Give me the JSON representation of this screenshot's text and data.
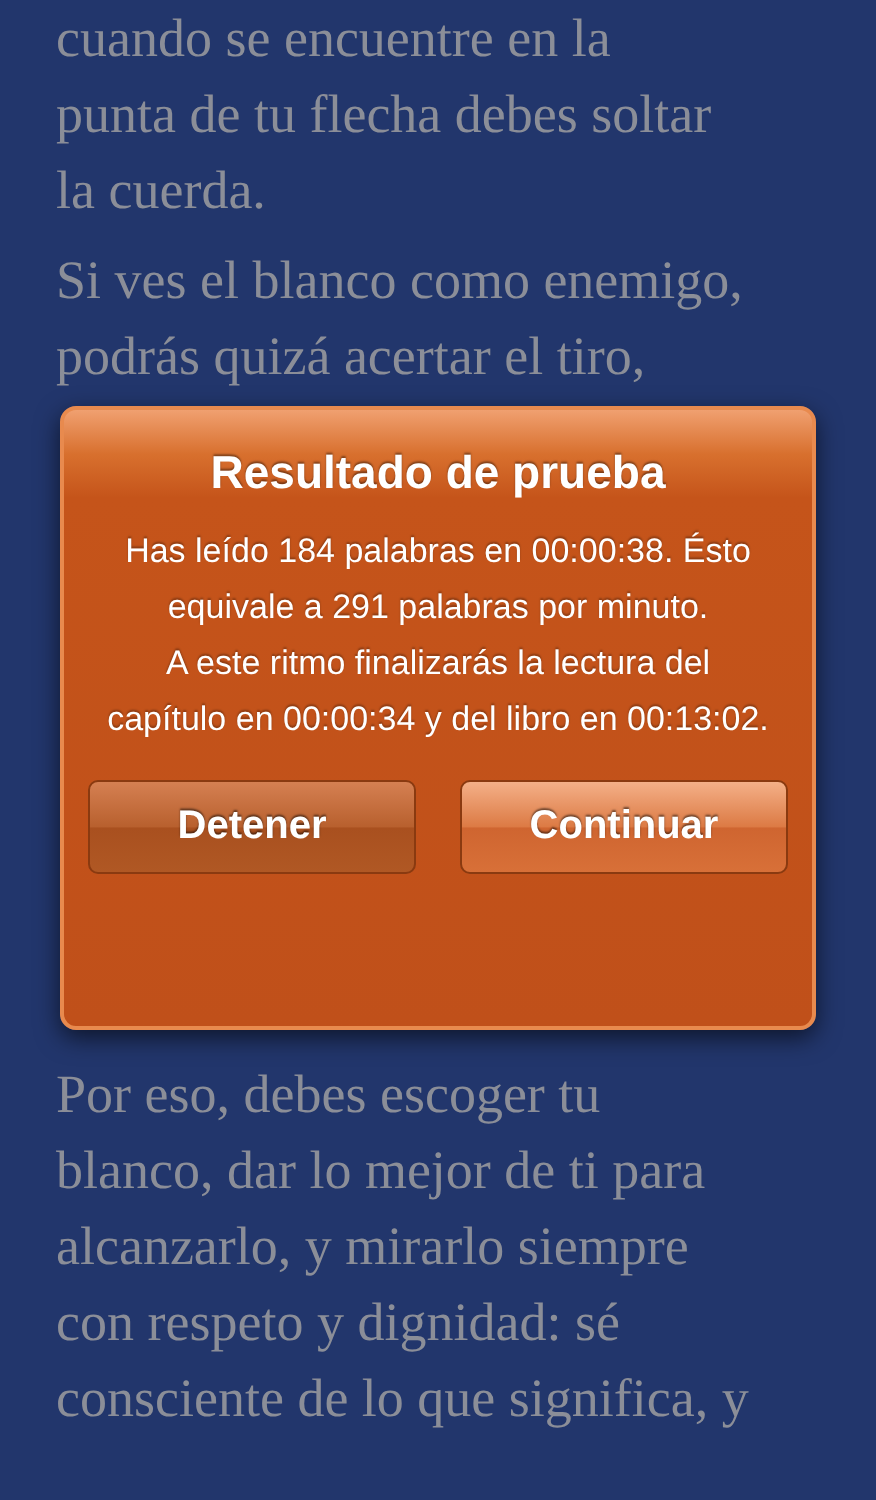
{
  "book_text": {
    "paragraphs_above": [
      {
        "lines": [
          "cuando se encuentre en la",
          "punta de tu flecha debes soltar",
          "la cuerda."
        ]
      },
      {
        "lines": [
          "Si ves el blanco como enemigo,",
          "podrás quizá acertar el tiro,"
        ]
      }
    ],
    "paragraphs_below": [
      {
        "lines": [
          "Por eso, debes escoger tu",
          "blanco, dar lo mejor de ti para",
          "alcanzarlo, y mirarlo siempre",
          "con respeto y dignidad: sé",
          "consciente de lo que significa, y"
        ]
      }
    ]
  },
  "alert": {
    "title": "Resultado de prueba",
    "message": [
      "Has leído 184 palabras en 00:00:38. Ésto equivale a 291 palabras por minuto.",
      "A este ritmo finalizarás la lectura del capítulo en 00:00:34 y del libro en 00:13:02."
    ],
    "buttons": [
      {
        "label": "Detener",
        "kind": "cancel"
      },
      {
        "label": "Continuar",
        "kind": "default"
      }
    ]
  }
}
